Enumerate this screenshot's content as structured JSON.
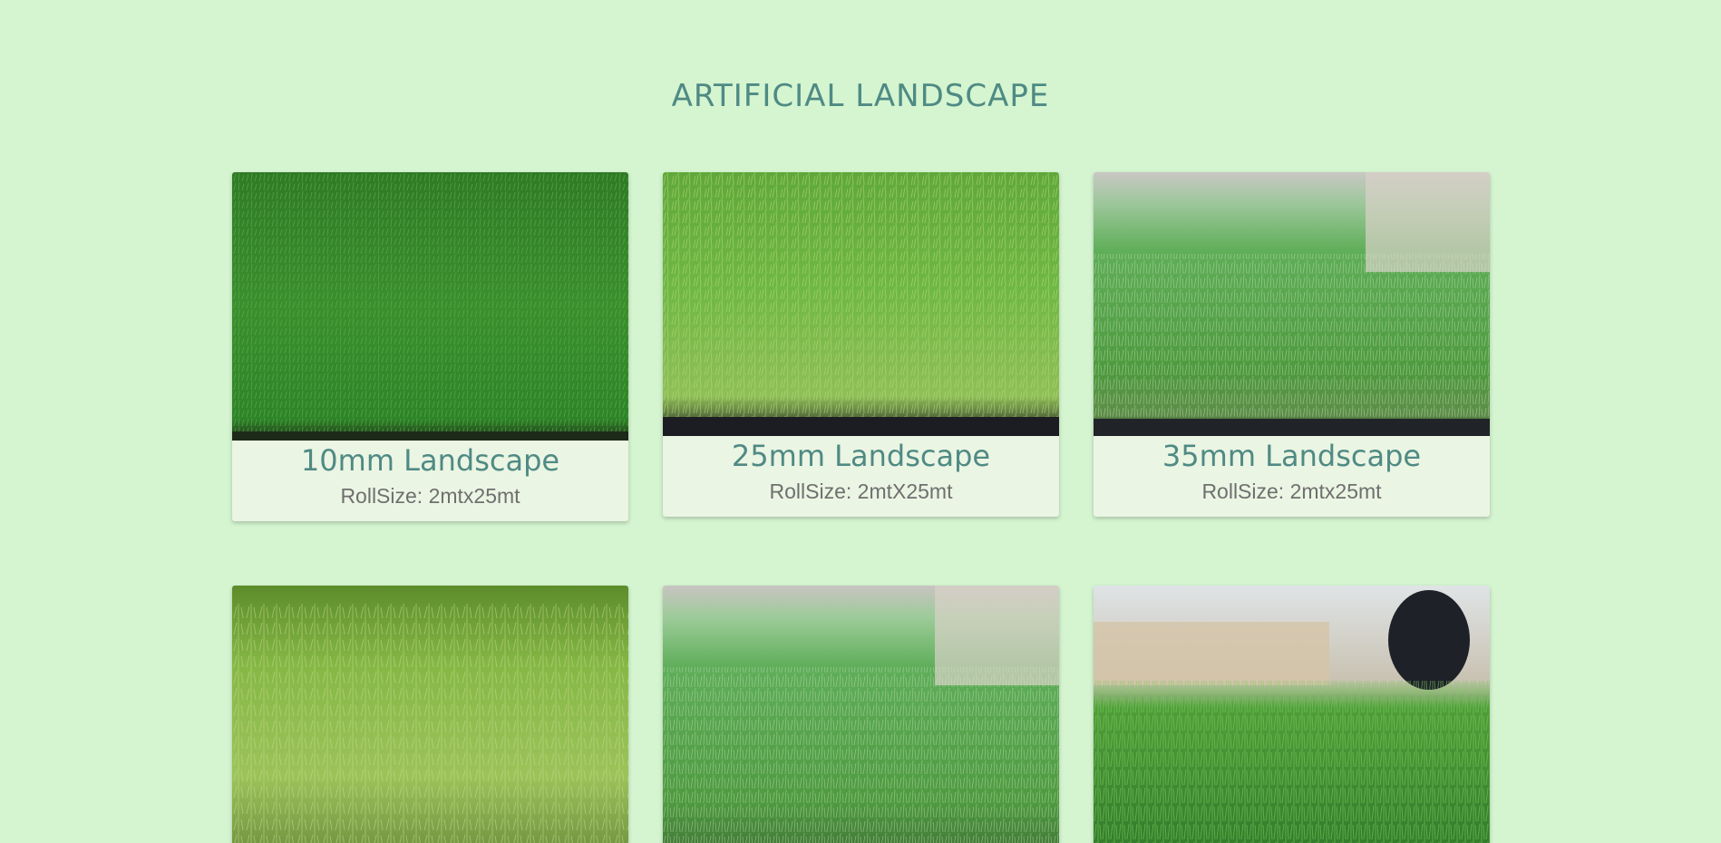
{
  "page": {
    "title": "ARTIFICIAL LANDSCAPE",
    "background_color": "#d4f5d0",
    "accent_color": "#4f8a84"
  },
  "products": [
    {
      "name": "10mm Landscape",
      "roll_size": "RollSize: 2mtx25mt",
      "image": "short-dense-grass-photo"
    },
    {
      "name": "25mm Landscape",
      "roll_size": "RollSize: 2mtX25mt",
      "image": "medium-grass-photo"
    },
    {
      "name": "35mm Landscape",
      "roll_size": "RollSize: 2mtx25mt",
      "image": "tall-grass-photo"
    },
    {
      "name": "",
      "roll_size": "",
      "image": "natural-grass-photo"
    },
    {
      "name": "",
      "roll_size": "",
      "image": "tall-grass-closeup-photo"
    },
    {
      "name": "",
      "roll_size": "",
      "image": "grass-edge-photo"
    }
  ]
}
